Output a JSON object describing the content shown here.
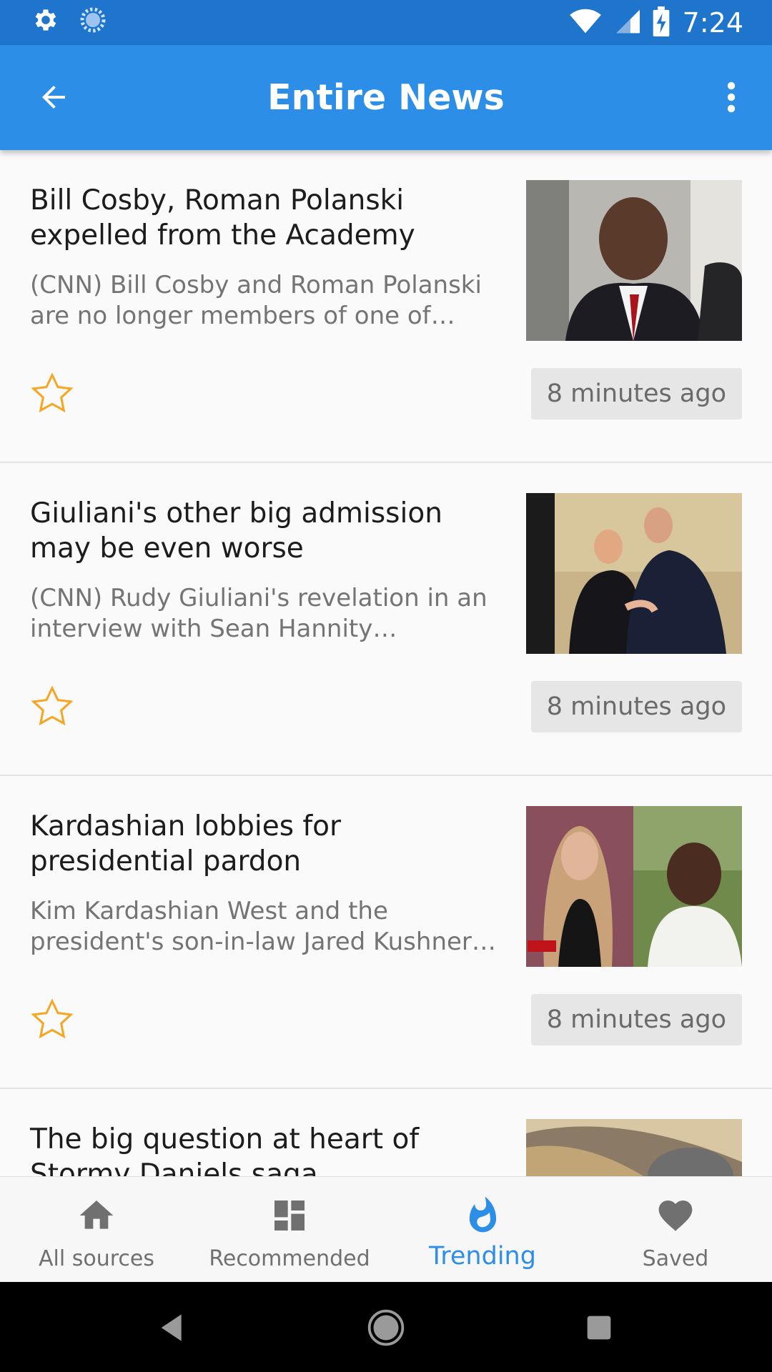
{
  "status_bar": {
    "time": "7:24",
    "icons": [
      "settings-icon",
      "sync-icon",
      "wifi-icon",
      "signal-icon",
      "battery-charging-icon"
    ]
  },
  "app_bar": {
    "title": "Entire News",
    "back_icon": "arrow-left-icon",
    "menu_icon": "more-vert-icon"
  },
  "articles": [
    {
      "headline": "Bill Cosby, Roman Polanski expelled from the Academy",
      "summary": "(CNN) Bill Cosby and Roman Polanski are no longer members of one of Hollywood's most prestigious organizations.",
      "time": "8 minutes ago",
      "saved": false
    },
    {
      "headline": "Giuliani's other big admission may be even worse",
      "summary": "(CNN) Rudy Giuliani's revelation in an interview with Sean Hannity Wednesday night was stunning.",
      "time": "8 minutes ago",
      "saved": false
    },
    {
      "headline": "Kardashian lobbies for presidential pardon",
      "summary": "Kim Kardashian West and the president's son-in-law Jared Kushner are working together.",
      "time": "8 minutes ago",
      "saved": false
    },
    {
      "headline": "The big question at heart of Stormy Daniels saga"
    }
  ],
  "bottom_nav": {
    "items": [
      {
        "label": "All sources",
        "icon": "home-icon",
        "active": false
      },
      {
        "label": "Recommended",
        "icon": "dashboard-icon",
        "active": false
      },
      {
        "label": "Trending",
        "icon": "flame-icon",
        "active": true
      },
      {
        "label": "Saved",
        "icon": "heart-icon",
        "active": false
      }
    ]
  },
  "colors": {
    "status_bar": "#1f74cc",
    "app_bar": "#2c8ee6",
    "accent": "#2c8ee6",
    "star": "#f5a623",
    "nav_inactive": "#707070"
  }
}
